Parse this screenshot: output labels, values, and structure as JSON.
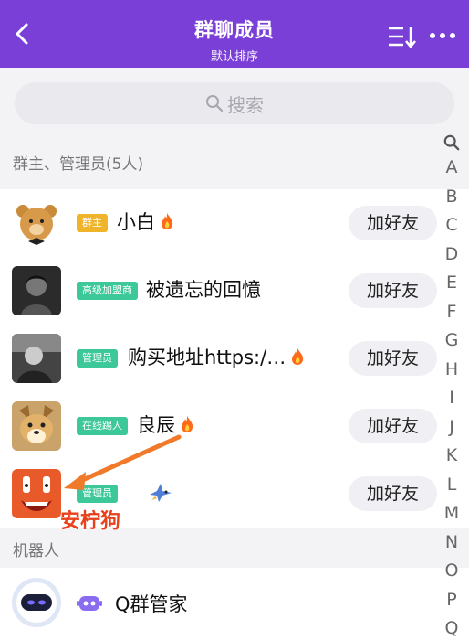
{
  "header": {
    "title": "群聊成员",
    "subtitle": "默认排序"
  },
  "search": {
    "placeholder": "搜索"
  },
  "sections": {
    "admins_label": "群主、管理员(5人)",
    "bots_label": "机器人"
  },
  "members": [
    {
      "badge": "群主",
      "badge_color": "#f0b42a",
      "name": "小白",
      "fire": true,
      "button": "加好友"
    },
    {
      "badge": "高级加盟商",
      "badge_color": "#3dc89a",
      "name": "被遗忘的回憶",
      "fire": false,
      "button": "加好友"
    },
    {
      "badge": "管理员",
      "badge_color": "#3dc89a",
      "name": "购买地址https:/…",
      "fire": true,
      "button": "加好友"
    },
    {
      "badge": "在线踢人",
      "badge_color": "#3dc89a",
      "name": "良辰",
      "fire": true,
      "button": "加好友"
    },
    {
      "badge": "管理员",
      "badge_color": "#3dc89a",
      "name": "",
      "fire": false,
      "button": "加好友"
    }
  ],
  "bots": [
    {
      "name": "Q群管家"
    }
  ],
  "annotation": "安柠狗",
  "alphabet": [
    "A",
    "B",
    "C",
    "D",
    "E",
    "F",
    "G",
    "H",
    "I",
    "J",
    "K",
    "L",
    "M",
    "N",
    "O",
    "P",
    "Q"
  ]
}
